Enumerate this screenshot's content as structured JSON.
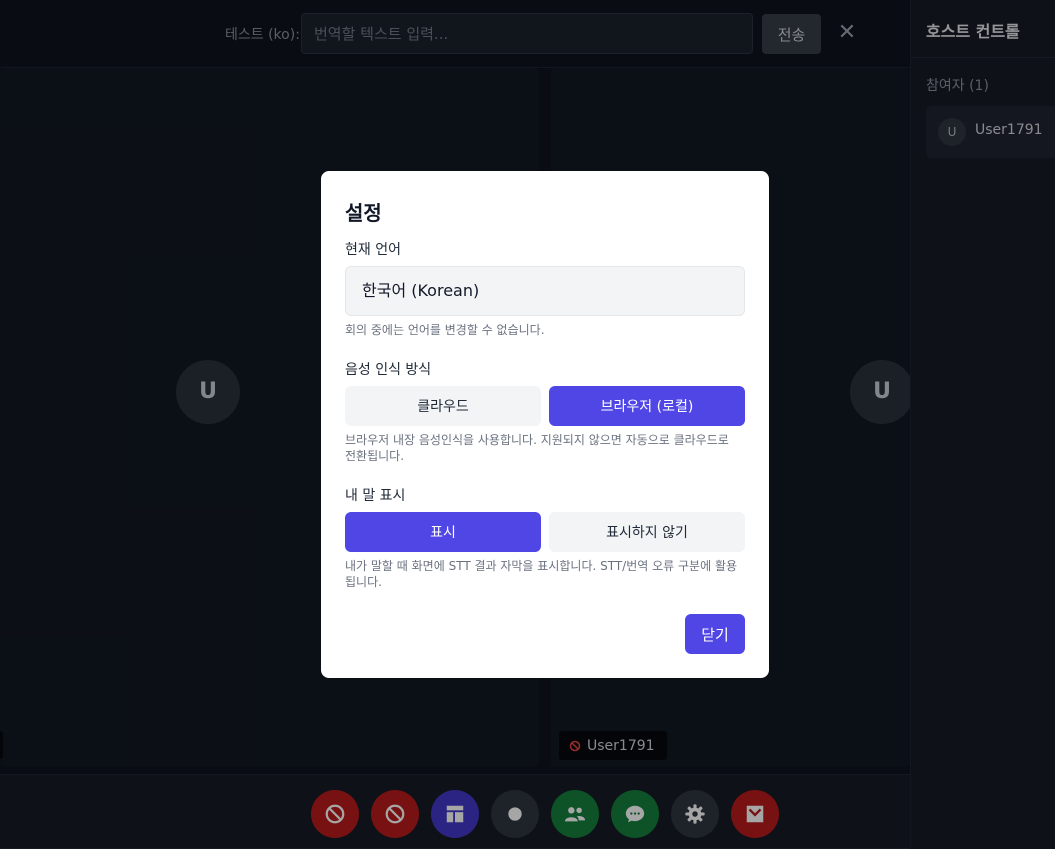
{
  "topbar": {
    "test_label": "테스트 (ko):",
    "input_placeholder": "번역할 텍스트 입력...",
    "send_label": "전송",
    "close_glyph": "✕"
  },
  "tiles": {
    "left_avatar": "U",
    "right_avatar": "U",
    "right_name": "User1791"
  },
  "sidebar": {
    "title": "호스트 컨트롤",
    "section": "참여자 (1)",
    "participants": [
      {
        "initial": "U",
        "name": "User1791"
      }
    ]
  },
  "controls": [
    {
      "name": "mic-off",
      "icon": "block-icon",
      "color": "red"
    },
    {
      "name": "camera-off",
      "icon": "block-icon",
      "color": "red"
    },
    {
      "name": "layout",
      "icon": "layout-icon",
      "color": "indigo"
    },
    {
      "name": "record",
      "icon": "record-icon",
      "color": "gray"
    },
    {
      "name": "participants",
      "icon": "people-icon",
      "color": "green"
    },
    {
      "name": "chat",
      "icon": "chat-icon",
      "color": "green"
    },
    {
      "name": "settings",
      "icon": "gear-icon",
      "color": "gray"
    },
    {
      "name": "leave",
      "icon": "leave-icon",
      "color": "red"
    }
  ],
  "colors": {
    "accent": "#4f46e5",
    "danger": "#b91c1c",
    "success": "#15803d",
    "background": "#0f131c"
  },
  "modal": {
    "title": "설정",
    "language_label": "현재 언어",
    "language_value": "한국어 (Korean)",
    "language_hint": "회의 중에는 언어를 변경할 수 없습니다.",
    "stt_label": "음성 인식 방식",
    "stt_options": [
      "클라우드",
      "브라우저 (로컬)"
    ],
    "stt_selected": "브라우저 (로컬)",
    "stt_hint": "브라우저 내장 음성인식을 사용합니다. 지원되지 않으면 자동으로 클라우드로 전환됩니다.",
    "display_label": "내 말 표시",
    "display_options": [
      "표시",
      "표시하지 않기"
    ],
    "display_selected": "표시",
    "display_hint": "내가 말할 때 화면에 STT 결과 자막을 표시합니다. STT/번역 오류 구분에 활용됩니다.",
    "close_label": "닫기"
  }
}
